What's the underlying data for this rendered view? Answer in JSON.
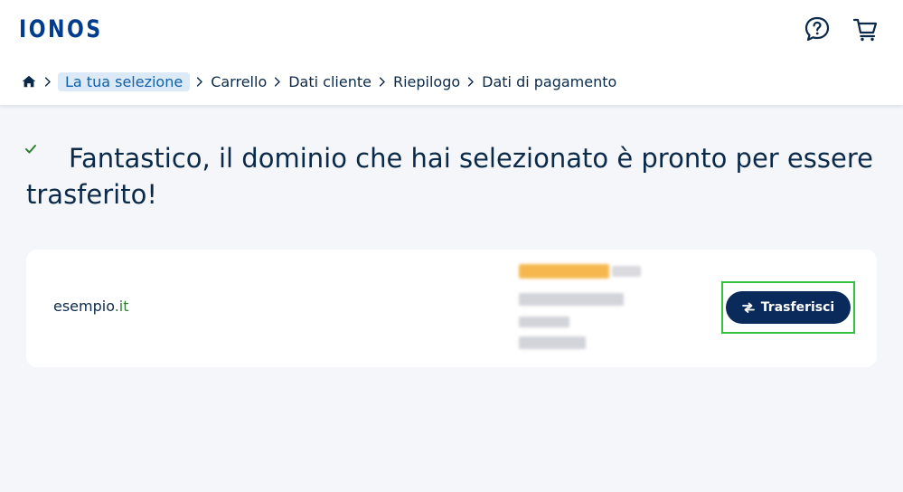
{
  "header": {
    "logo": "IONOS",
    "help_icon": "question-bubble-icon",
    "cart_icon": "shopping-cart-icon"
  },
  "breadcrumb": {
    "home_icon": "home-icon",
    "items": [
      "La tua selezione",
      "Carrello",
      "Dati cliente",
      "Riepilogo",
      "Dati di pagamento"
    ]
  },
  "main": {
    "check_icon": "checkmark-icon",
    "headline": "Fantastico, il dominio che hai selezionato è pronto per essere trasferito!"
  },
  "domain_card": {
    "domain_name": "esempio",
    "domain_tld": ".it",
    "transfer_button": "Trasferisci",
    "transfer_icon": "swap-arrows-icon"
  },
  "colors": {
    "brand": "#003d8f",
    "text": "#0b2a4a",
    "button": "#0b2a5c",
    "active_crumb_bg": "#dbeaf6",
    "active_crumb_text": "#1160a8",
    "tld": "#2e7d32",
    "highlight_frame": "#34c23a",
    "page_bg": "#f4f6fa"
  }
}
